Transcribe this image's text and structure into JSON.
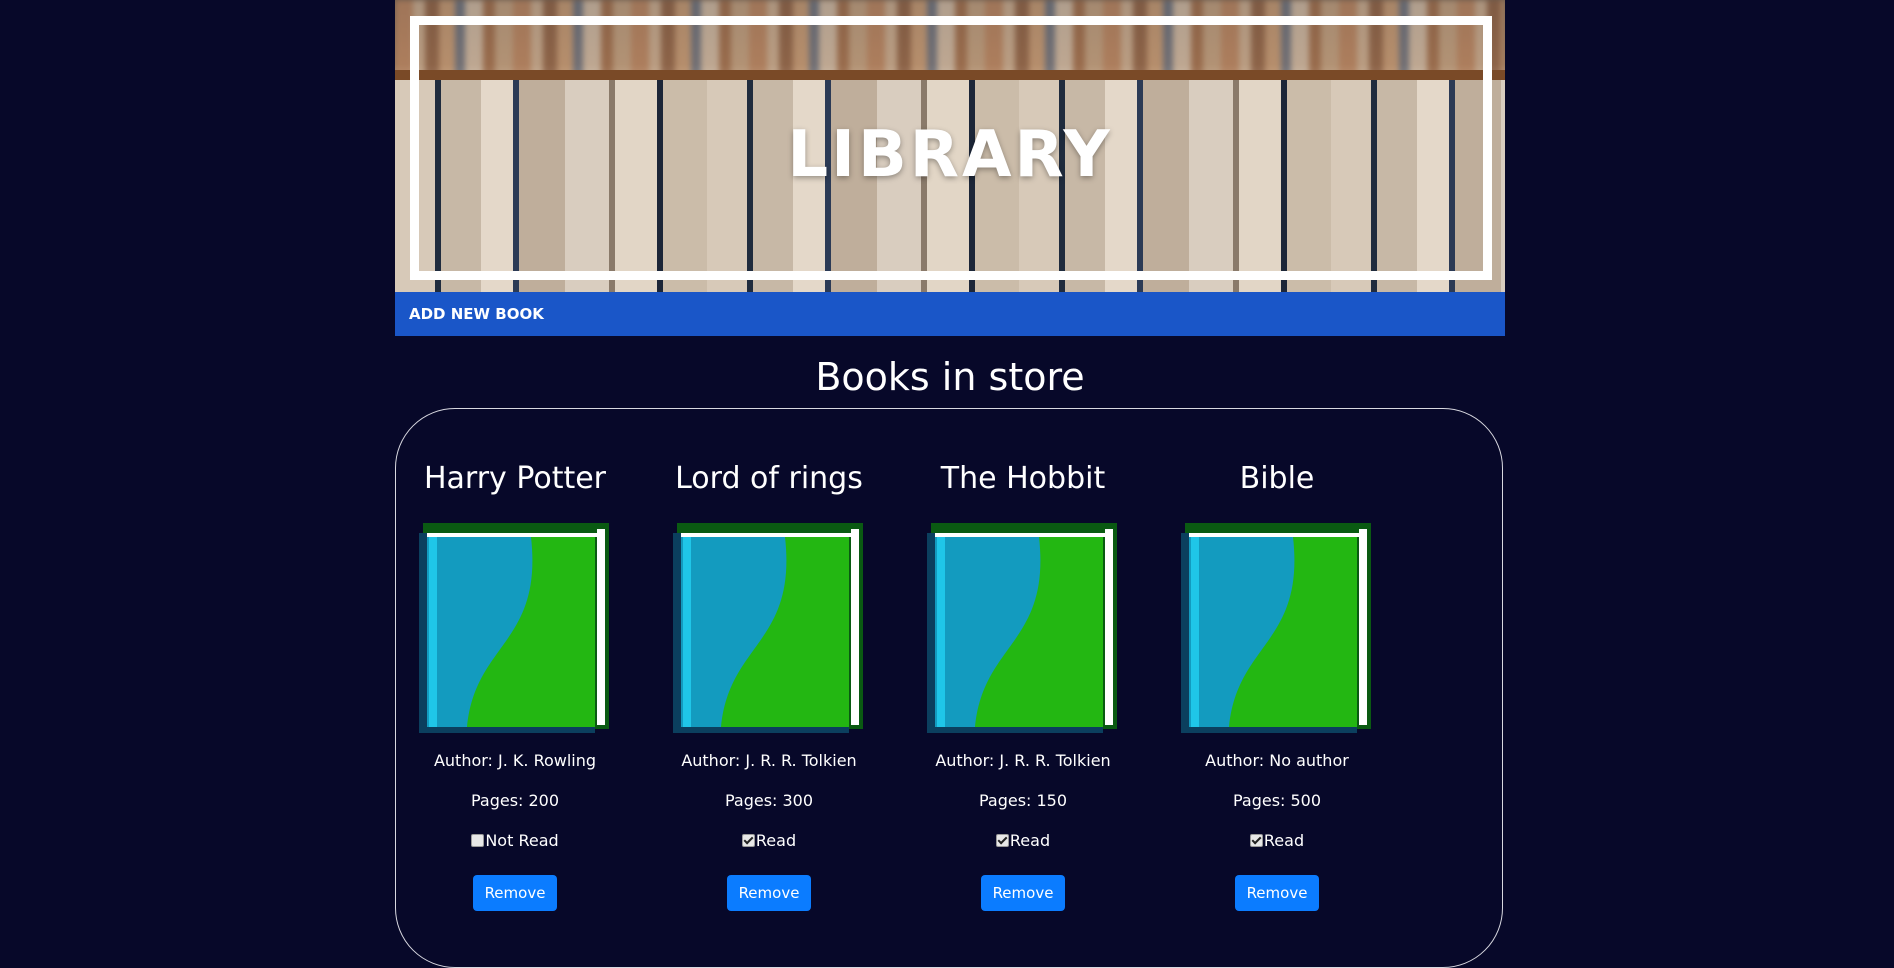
{
  "hero": {
    "title": "LIBRARY"
  },
  "nav": {
    "add_book_label": "ADD NEW BOOK"
  },
  "main": {
    "heading": "Books in store"
  },
  "books": [
    {
      "title": "Harry Potter",
      "author": "Author: J. K. Rowling",
      "pages": "Pages: 200",
      "read": false,
      "read_label": "Not Read",
      "remove_label": "Remove"
    },
    {
      "title": "Lord of rings",
      "author": "Author: J. R. R. Tolkien",
      "pages": "Pages: 300",
      "read": true,
      "read_label": "Read",
      "remove_label": "Remove"
    },
    {
      "title": "The Hobbit",
      "author": "Author: J. R. R. Tolkien",
      "pages": "Pages: 150",
      "read": true,
      "read_label": "Read",
      "remove_label": "Remove"
    },
    {
      "title": "Bible",
      "author": "Author: No author",
      "pages": "Pages: 500",
      "read": true,
      "read_label": "Read",
      "remove_label": "Remove"
    }
  ],
  "colors": {
    "page_background": "#070829",
    "nav_background": "#1a56c8",
    "remove_button": "#0b7cff",
    "cover_blue": "#139bbf",
    "cover_green": "#23b712"
  },
  "icons": {
    "book_cover": "book-cover-icon"
  }
}
